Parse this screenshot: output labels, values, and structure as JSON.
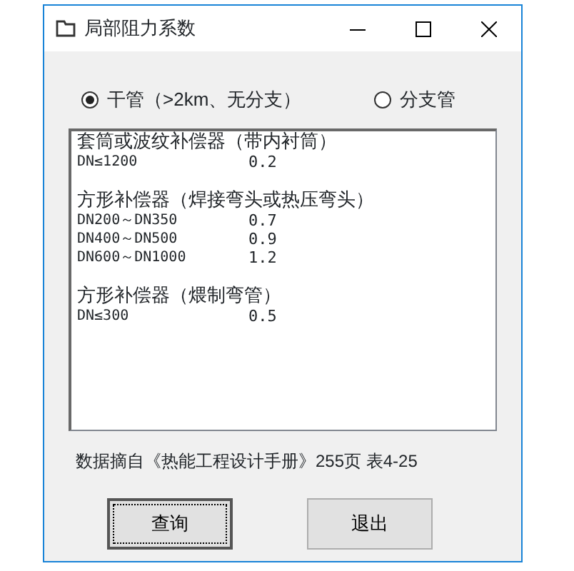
{
  "window": {
    "title": "局部阻力系数"
  },
  "pipe_type": [
    {
      "label": "干管（>2km、无分支）",
      "selected": true
    },
    {
      "label": "分支管",
      "selected": false
    }
  ],
  "coefficients": [
    {
      "title": "套筒或波纹补偿器（带内衬筒）",
      "entries": [
        {
          "size": "DN≤1200",
          "value": "0.2"
        }
      ]
    },
    {
      "title": "方形补偿器（焊接弯头或热压弯头）",
      "entries": [
        {
          "size": "DN200～DN350",
          "value": "0.7"
        },
        {
          "size": "DN400～DN500",
          "value": "0.9"
        },
        {
          "size": "DN600～DN1000",
          "value": "1.2"
        }
      ]
    },
    {
      "title": "方形补偿器（煨制弯管）",
      "entries": [
        {
          "size": "DN≤300",
          "value": "0.5"
        }
      ]
    }
  ],
  "source_note": "数据摘自《热能工程设计手册》255页 表4-25",
  "buttons": [
    "查询",
    "退出"
  ]
}
